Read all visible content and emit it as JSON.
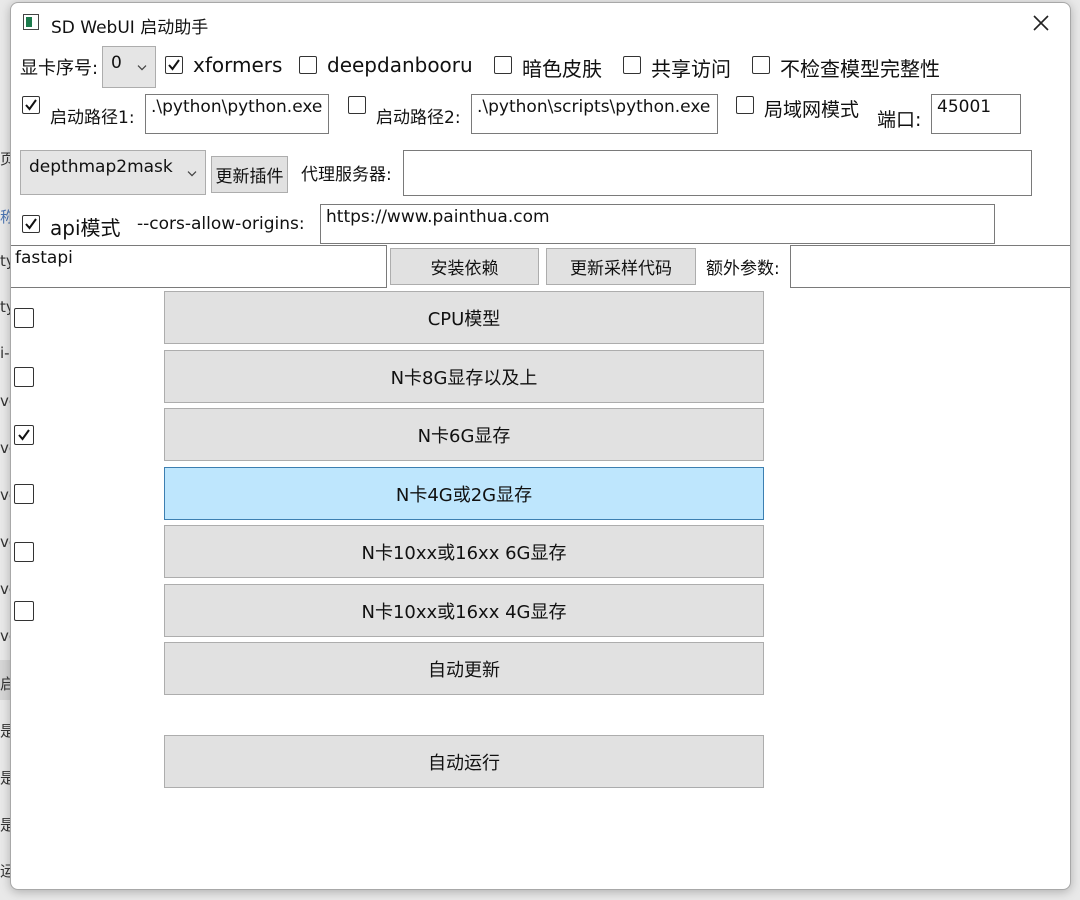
{
  "window": {
    "title": "SD WebUI 启动助手"
  },
  "row1": {
    "gpu_label": "显卡序号:",
    "gpu_value": "0",
    "options": [
      {
        "label": "xformers",
        "checked": true
      },
      {
        "label": "deepdanbooru",
        "checked": false
      },
      {
        "label": "暗色皮肤",
        "checked": false
      },
      {
        "label": "共享访问",
        "checked": false
      },
      {
        "label": "不检查模型完整性",
        "checked": false
      }
    ]
  },
  "row2": {
    "path1": {
      "label": "启动路径1:",
      "checked": true,
      "value": ".\\python\\python.exe"
    },
    "path2": {
      "label": "启动路径2:",
      "checked": false,
      "value": ".\\python\\scripts\\python.exe"
    },
    "lan": {
      "label": "局域网模式",
      "checked": false
    },
    "port": {
      "label": "端口:",
      "value": "45001"
    }
  },
  "row3": {
    "plugin_select": "depthmap2mask",
    "update_plugin": "更新插件",
    "proxy_label": "代理服务器:",
    "proxy_value": ""
  },
  "row4": {
    "api": {
      "label": "api模式",
      "checked": true
    },
    "cors_label": "--cors-allow-origins:",
    "cors_value": "https://www.painthua.com"
  },
  "row5": {
    "deps_value": "fastapi",
    "install_deps": "安装依赖",
    "update_sampler": "更新采样代码",
    "extra_label": "额外参数:",
    "extra_value": ""
  },
  "modes": [
    {
      "label": "CPU模型",
      "checked": false,
      "hover": false
    },
    {
      "label": "N卡8G显存以及上",
      "checked": false,
      "hover": false
    },
    {
      "label": "N卡6G显存",
      "checked": true,
      "hover": false
    },
    {
      "label": "N卡4G或2G显存",
      "checked": false,
      "hover": true
    },
    {
      "label": "N卡10xx或16xx 6G显存",
      "checked": false,
      "hover": false
    },
    {
      "label": "N卡10xx或16xx 4G显存",
      "checked": false,
      "hover": false
    }
  ],
  "auto_update": "自动更新",
  "auto_run": "自动运行",
  "bg_fragments": [
    "页",
    "称",
    "ty",
    "ty",
    "i-",
    "ve",
    "ve",
    "ve",
    "ve",
    "ve",
    "ve",
    "启",
    "是",
    "是",
    "是",
    "运"
  ],
  "colors": {
    "hover_button": "#bee6fd",
    "button": "#e1e1e1",
    "window_bg": "#ffffff"
  }
}
